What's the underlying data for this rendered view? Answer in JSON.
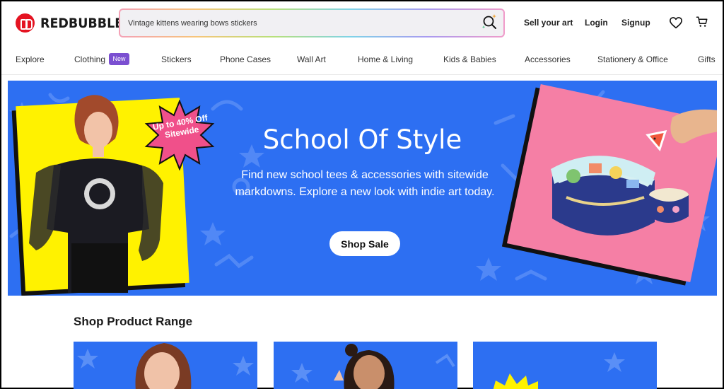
{
  "brand": {
    "name": "REDBUBBLE"
  },
  "search": {
    "value": "Vintage kittens wearing bows stickers"
  },
  "header": {
    "sell": "Sell your art",
    "login": "Login",
    "signup": "Signup"
  },
  "nav": {
    "items": [
      {
        "label": "Explore"
      },
      {
        "label": "Clothing",
        "badge": "New"
      },
      {
        "label": "Stickers"
      },
      {
        "label": "Phone Cases"
      },
      {
        "label": "Wall Art"
      },
      {
        "label": "Home & Living"
      },
      {
        "label": "Kids & Babies"
      },
      {
        "label": "Accessories"
      },
      {
        "label": "Stationery & Office"
      },
      {
        "label": "Gifts"
      }
    ]
  },
  "hero": {
    "title": "School Of Style",
    "subtitle": "Find new school tees & accessories with sitewide markdowns. Explore a new look with indie art today.",
    "promo": "Up to 40% Off Sitewide",
    "cta": "Shop Sale"
  },
  "sections": {
    "product_range_title": "Shop Product Range"
  },
  "colors": {
    "accent_blue": "#2d6ff2",
    "brand_red": "#e41321",
    "new_badge": "#7b4fd1",
    "promo_pink": "#f0508a"
  },
  "icons": {
    "search": "search-sparkle-icon",
    "wishlist": "heart-icon",
    "cart": "cart-icon",
    "logo": "redbubble-logo-icon"
  }
}
